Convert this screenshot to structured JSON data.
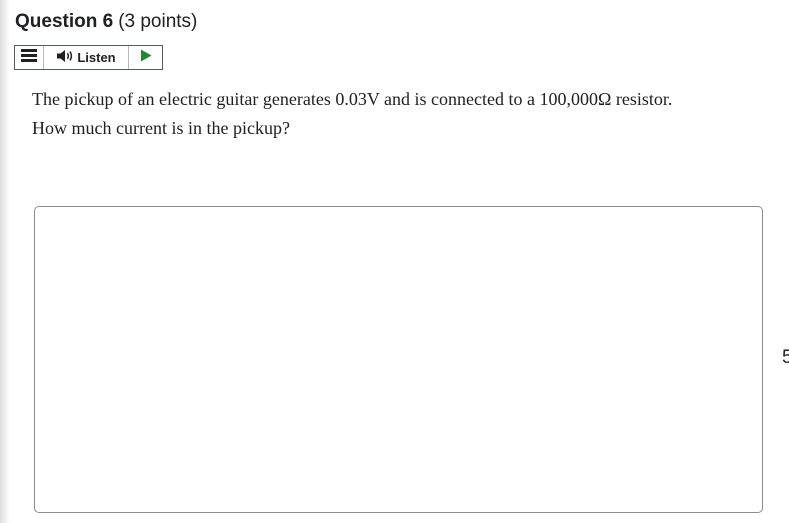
{
  "question": {
    "title": "Question 6",
    "points": "(3 points)"
  },
  "toolbar": {
    "menu_icon": "hamburger-menu-icon",
    "speaker_icon": "speaker-icon",
    "listen_label": "Listen",
    "play_icon": "play-icon",
    "accent_color": "#1e8a2e"
  },
  "body": {
    "line1": "The pickup of an electric guitar generates 0.03V and is connected to a 100,000Ω resistor.",
    "line2": "How much current is in the pickup?"
  },
  "answer": {
    "value": ""
  },
  "edge_fragment": "5"
}
